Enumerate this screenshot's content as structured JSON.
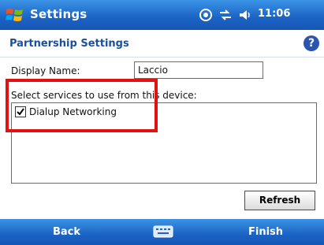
{
  "titlebar": {
    "app_title": "Settings",
    "clock": "11:06",
    "icons": [
      "start-flag-icon",
      "sync-icon",
      "connectivity-icon",
      "volume-icon"
    ]
  },
  "header": {
    "title": "Partnership Settings",
    "help_glyph": "?"
  },
  "form": {
    "display_name_label": "Display Name:",
    "display_name_value": "Laccio",
    "services_label": "Select services to use from this device:",
    "services": [
      {
        "label": "Dialup Networking",
        "checked": true
      }
    ],
    "refresh_label": "Refresh"
  },
  "menubar": {
    "left_softkey": "Back",
    "right_softkey": "Finish",
    "center_icon": "keyboard-icon"
  },
  "colors": {
    "bar_blue": "#1b63c4",
    "title_blue": "#1b4f9c",
    "highlight_red": "#e01313"
  }
}
